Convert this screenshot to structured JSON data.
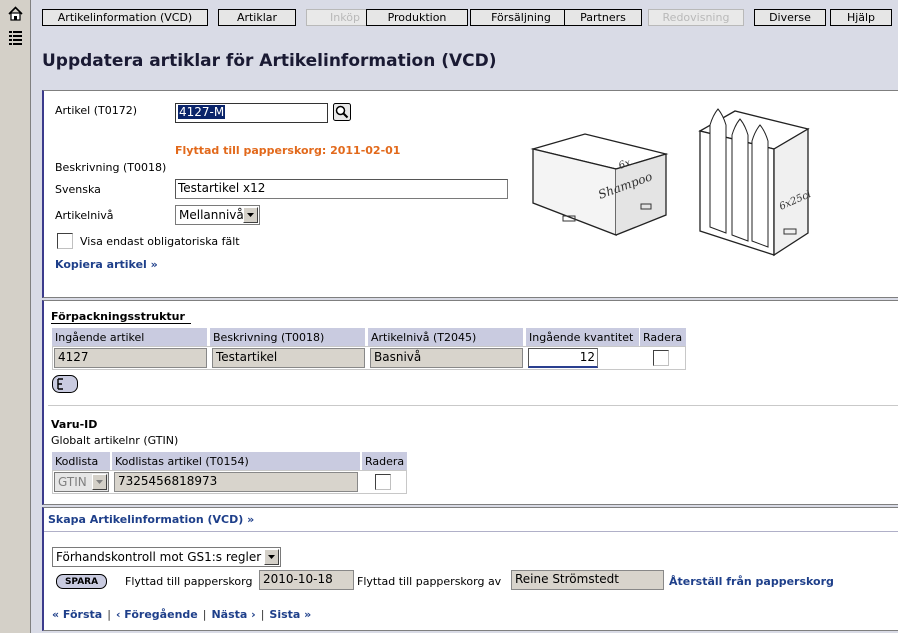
{
  "nav": {
    "tabs": [
      {
        "label": "Artikelinformation (VCD)",
        "enabled": true
      },
      {
        "label": "Artiklar",
        "enabled": true
      },
      {
        "label": "Inköp",
        "enabled": false
      },
      {
        "label": "Produktion",
        "enabled": true
      },
      {
        "label": "Försäljning",
        "enabled": true
      },
      {
        "label": "Partners",
        "enabled": true
      },
      {
        "label": "Redovisning",
        "enabled": false
      },
      {
        "label": "Diverse",
        "enabled": true
      },
      {
        "label": "Hjälp",
        "enabled": true
      }
    ]
  },
  "page": {
    "title": "Uppdatera artiklar för Artikelinformation (VCD)"
  },
  "article": {
    "article_label": "Artikel (T0172)",
    "article_value": "4127-M",
    "moved_notice": "Flyttad till papperskorg: 2011-02-01",
    "description_label": "Beskrivning (T0018)",
    "swedish_label": "Svenska",
    "swedish_value": "Testartikel x12",
    "level_label": "Artikelnivå",
    "level_value": "Mellannivå",
    "mandatory_only_label": "Visa endast obligatoriska fält",
    "copy_link": "Kopiera artikel »",
    "image1_text_top": "6x",
    "image1_text_main": "Shampoo",
    "image2_text": "6x25cl"
  },
  "packaging": {
    "title": "Förpackningsstruktur",
    "headers": [
      "Ingående artikel",
      "Beskrivning (T0018)",
      "Artikelnivå (T2045)",
      "Ingående kvantitet",
      "Radera"
    ],
    "row": {
      "article": "4127",
      "description": "Testartikel",
      "level": "Basnivå",
      "quantity": "12"
    }
  },
  "varuid": {
    "title": "Varu-ID",
    "subtitle": "Globalt artikelnr (GTIN)",
    "headers": [
      "Kodlista",
      "Kodlistas artikel (T0154)",
      "Radera"
    ],
    "row": {
      "codelist": "GTIN",
      "code": "7325456818973"
    }
  },
  "footer": {
    "create_link": "Skapa Artikelinformation (VCD) »",
    "precheck_value": "Förhandskontroll mot GS1:s regler",
    "save_label": "SPARA",
    "moved_label": "Flyttad till papperskorg",
    "moved_date": "2010-10-18",
    "moved_by_label": "Flyttad till papperskorg av",
    "moved_by": "Reine Strömstedt",
    "restore_link": "Återställ från papperskorg",
    "pager": {
      "first": "« Första",
      "prev": "‹ Föregående",
      "next": "Nästa ›",
      "last": "Sista »",
      "sep": "|"
    }
  }
}
